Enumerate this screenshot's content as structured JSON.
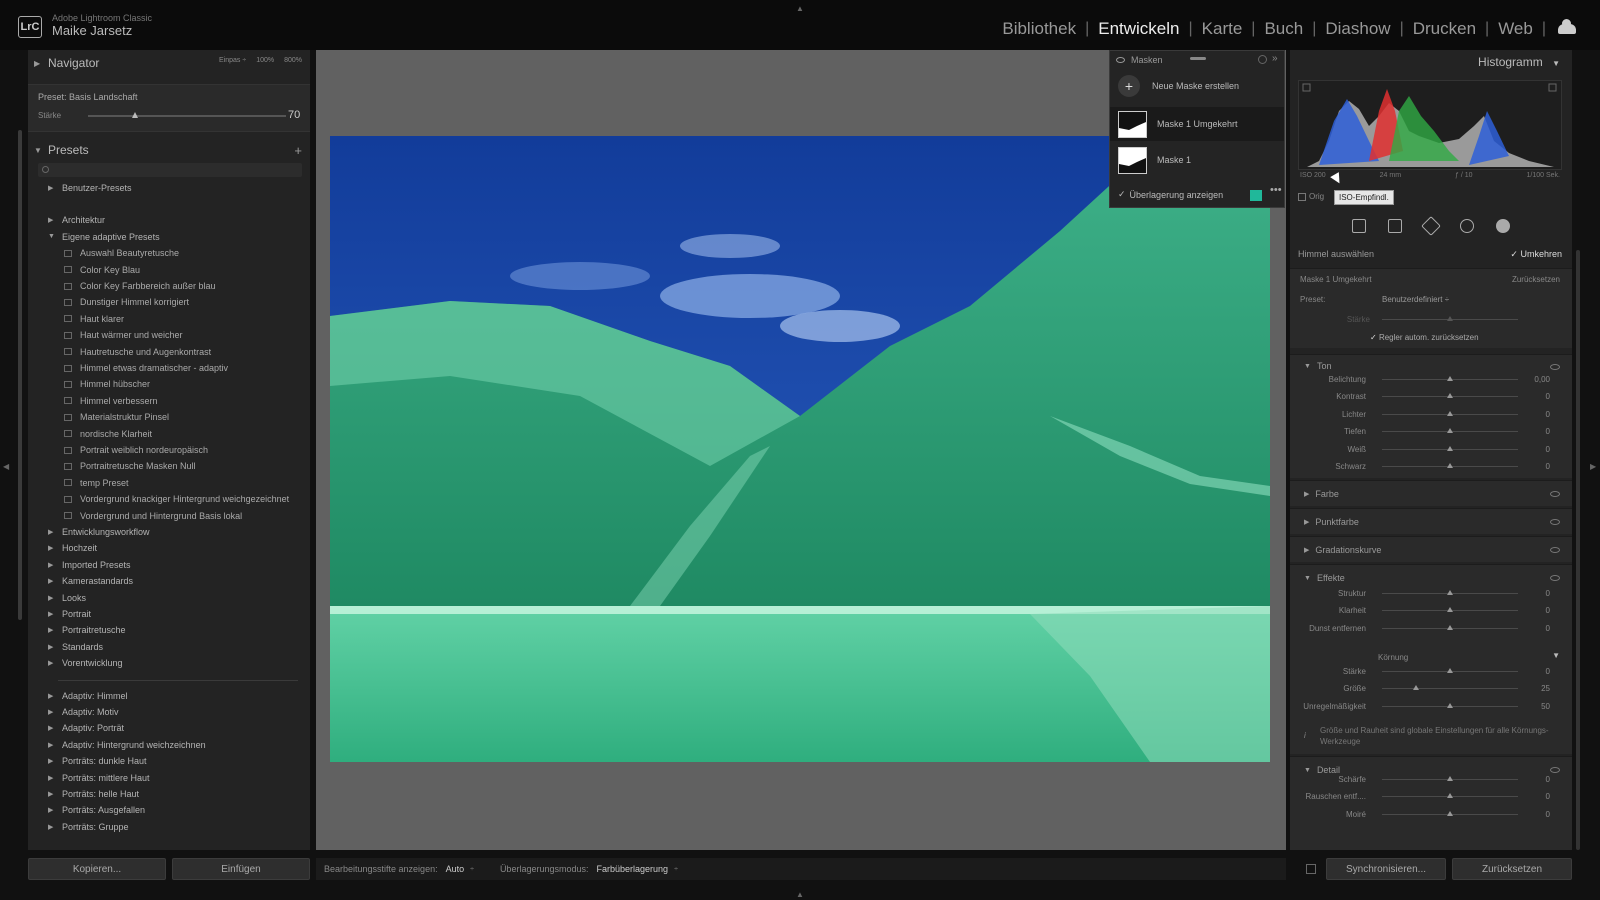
{
  "app": {
    "logo_text": "LrC",
    "name": "Adobe Lightroom Classic",
    "user": "Maike Jarsetz",
    "modules": [
      "Bibliothek",
      "Entwickeln",
      "Karte",
      "Buch",
      "Diashow",
      "Drucken",
      "Web"
    ],
    "active_module": "Entwickeln"
  },
  "navigator": {
    "title": "Navigator",
    "options": [
      "Einpas ÷",
      "100%",
      "800%"
    ]
  },
  "preset_info": {
    "preset_label": "Preset: Basis Landschaft",
    "strength_label": "Stärke",
    "strength_value": "70"
  },
  "presets": {
    "title": "Presets",
    "add": "+",
    "groups": [
      {
        "label": "Benutzer-Presets",
        "expanded": false
      },
      {
        "label": "Architektur",
        "expanded": false
      },
      {
        "label": "Eigene adaptive Presets",
        "expanded": true
      },
      {
        "label": "Entwicklungsworkflow",
        "expanded": false
      },
      {
        "label": "Hochzeit",
        "expanded": false
      },
      {
        "label": "Imported Presets",
        "expanded": false
      },
      {
        "label": "Kamerastandards",
        "expanded": false
      },
      {
        "label": "Looks",
        "expanded": false
      },
      {
        "label": "Portrait",
        "expanded": false
      },
      {
        "label": "Portraitretusche",
        "expanded": false
      },
      {
        "label": "Standards",
        "expanded": false
      },
      {
        "label": "Vorentwicklung",
        "expanded": false
      },
      {
        "label": "Adaptiv: Himmel",
        "expanded": false
      },
      {
        "label": "Adaptiv: Motiv",
        "expanded": false
      },
      {
        "label": "Adaptiv: Porträt",
        "expanded": false
      },
      {
        "label": "Adaptiv: Hintergrund weichzeichnen",
        "expanded": false
      },
      {
        "label": "Porträts: dunkle Haut",
        "expanded": false
      },
      {
        "label": "Porträts: mittlere Haut",
        "expanded": false
      },
      {
        "label": "Porträts: helle Haut",
        "expanded": false
      },
      {
        "label": "Porträts: Ausgefallen",
        "expanded": false
      },
      {
        "label": "Porträts: Gruppe",
        "expanded": false
      }
    ],
    "children": [
      "Auswahl Beautyretusche",
      "Color Key Blau",
      "Color Key Farbbereich außer blau",
      "Dunstiger Himmel korrigiert",
      "Haut klarer",
      "Haut wärmer und weicher",
      "Hautretusche und Augenkontrast",
      "Himmel etwas dramatischer - adaptiv",
      "Himmel hübscher",
      "Himmel verbessern",
      "Materialstruktur Pinsel",
      "nordische Klarheit",
      "Portrait weiblich nordeuropäisch",
      "Portraitretusche Masken Null",
      "temp Preset",
      "Vordergrund knackiger Hintergrund weichgezeichnet",
      "Vordergrund und Hintergrund Basis lokal"
    ]
  },
  "left_buttons": {
    "copy": "Kopieren...",
    "paste": "Einfügen"
  },
  "toolbar": {
    "pins_label": "Bearbeitungsstifte anzeigen:",
    "pins_value": "Auto",
    "overlay_label": "Überlagerungsmodus:",
    "overlay_value": "Farbüberlagerung",
    "dropdown_glyph": "÷"
  },
  "masks": {
    "title": "Masken",
    "new_mask": "Neue Maske erstellen",
    "items": [
      "Maske 1 Umgekehrt",
      "Maske 1"
    ],
    "selected": "Maske 1 Umgekehrt",
    "overlay_label": "Überlagerung anzeigen",
    "overlay_checked": true,
    "overlay_color": "#20b89a",
    "more": "•••"
  },
  "histogram": {
    "title": "Histogramm",
    "iso": "ISO 200",
    "focal": "24 mm",
    "aperture": "ƒ / 10",
    "shutter": "1/100 Sek.",
    "original_label": "Orig",
    "tooltip": "ISO-Empfindl."
  },
  "mask_settings": {
    "sky_label": "Himmel auswählen",
    "invert_label": "Umkehren",
    "invert_checked": true,
    "mask_name": "Maske 1 Umgekehrt",
    "reset_label": "Zurücksetzen",
    "preset_label": "Preset:",
    "preset_value": "Benutzerdefiniert ÷",
    "amount_label": "Stärke",
    "auto_reset_label": "Regler autom. zurücksetzen",
    "auto_reset_checked": true,
    "sections": {
      "ton": "Ton",
      "farbe": "Farbe",
      "punktfarbe": "Punktfarbe",
      "gradationskurve": "Gradationskurve",
      "effekte": "Effekte",
      "detail": "Detail"
    },
    "ton_sliders": [
      {
        "label": "Belichtung",
        "value": "0,00",
        "level": 0.5
      },
      {
        "label": "Kontrast",
        "value": "0",
        "level": 0.5
      },
      {
        "label": "Lichter",
        "value": "0",
        "level": 0.5
      },
      {
        "label": "Tiefen",
        "value": "0",
        "level": 0.5
      },
      {
        "label": "Weiß",
        "value": "0",
        "level": 0.5
      },
      {
        "label": "Schwarz",
        "value": "0",
        "level": 0.5
      }
    ],
    "effekte_sliders": [
      {
        "label": "Struktur",
        "value": "0",
        "level": 0.5
      },
      {
        "label": "Klarheit",
        "value": "0",
        "level": 0.5
      },
      {
        "label": "Dunst entfernen",
        "value": "0",
        "level": 0.5
      }
    ],
    "koernung_label": "Körnung",
    "koernung_sliders": [
      {
        "label": "Stärke",
        "value": "0",
        "level": 0.5
      },
      {
        "label": "Größe",
        "value": "25",
        "level": 0.25
      },
      {
        "label": "Unregelmäßigkeit",
        "value": "50",
        "level": 0.5
      }
    ],
    "info_text": "Größe und Rauheit sind globale Einstellungen für alle Körnungs-Werkzeuge",
    "detail_sliders": [
      {
        "label": "Schärfe",
        "value": "0",
        "level": 0.5
      },
      {
        "label": "Rauschen entf....",
        "value": "0",
        "level": 0.5
      },
      {
        "label": "Moiré",
        "value": "0",
        "level": 0.5
      }
    ]
  },
  "right_buttons": {
    "sync": "Synchronisieren...",
    "reset": "Zurücksetzen"
  }
}
